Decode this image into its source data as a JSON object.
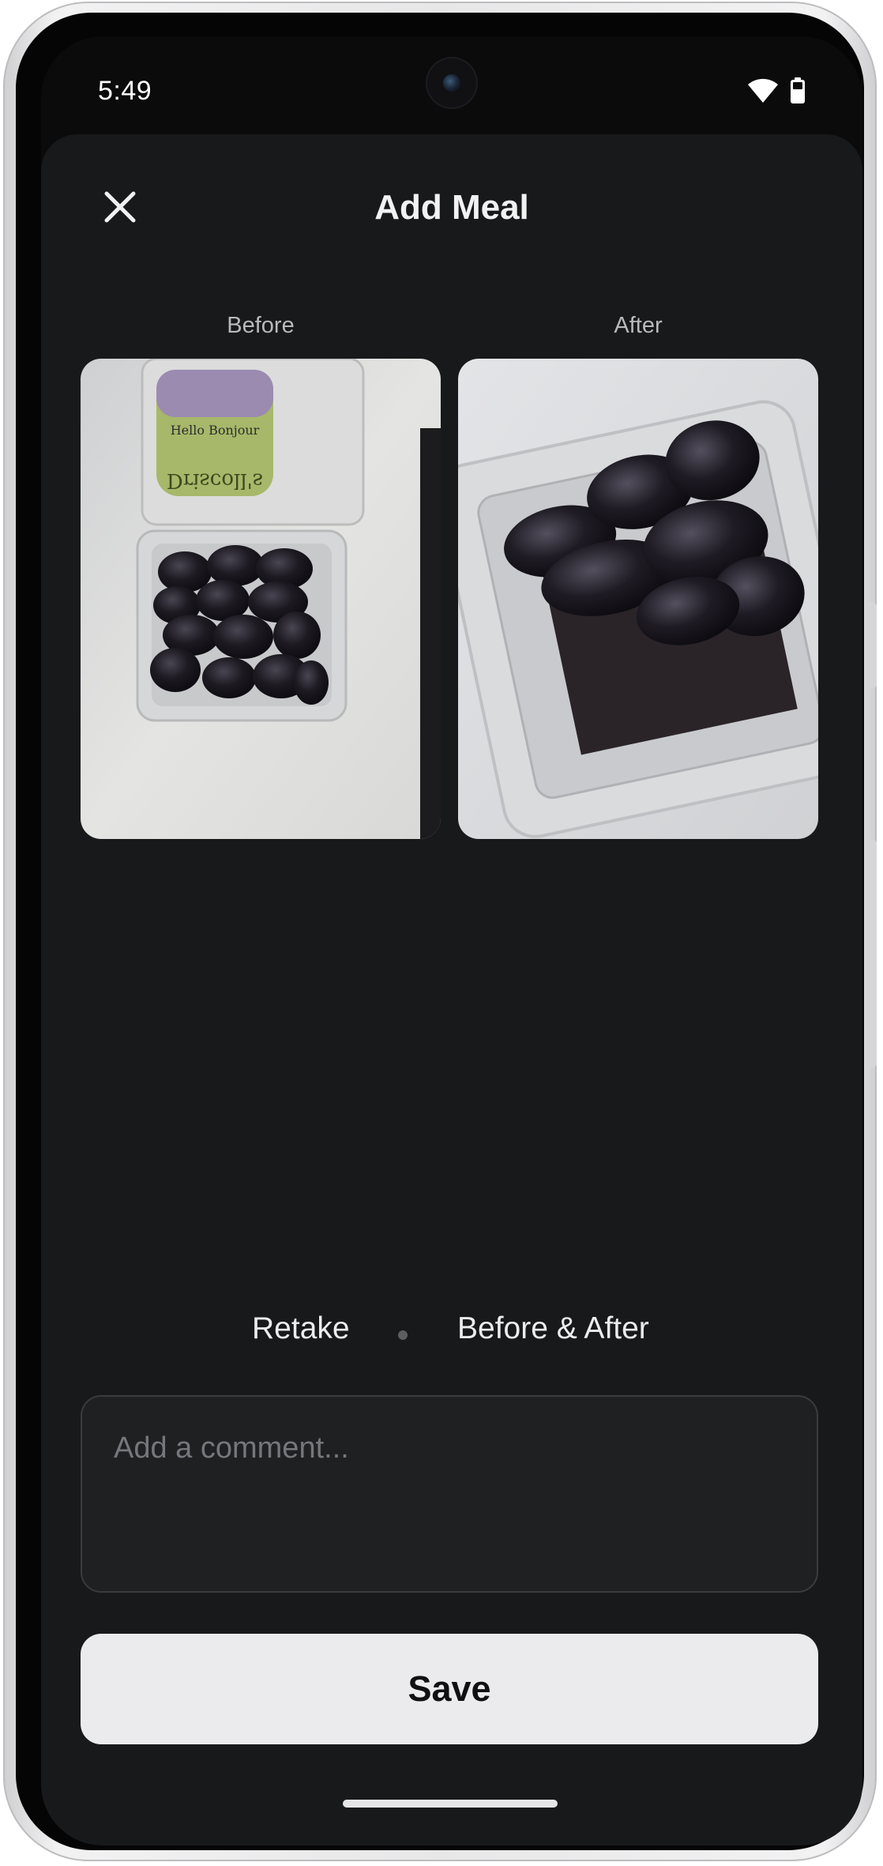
{
  "status_bar": {
    "time": "5:49",
    "icons": [
      "wifi-icon",
      "battery-icon"
    ]
  },
  "header": {
    "title": "Add Meal",
    "close_icon": "close-icon"
  },
  "photos": {
    "before_label": "Before",
    "after_label": "After"
  },
  "actions": {
    "retake_label": "Retake",
    "separator": "•",
    "before_after_label": "Before & After"
  },
  "comment": {
    "placeholder": "Add a comment..."
  },
  "save": {
    "label": "Save"
  },
  "colors": {
    "sheet_background": "#18191b",
    "save_button": "#ebebed",
    "text_primary": "#f2f2f3",
    "text_secondary": "#b9b9bd"
  }
}
